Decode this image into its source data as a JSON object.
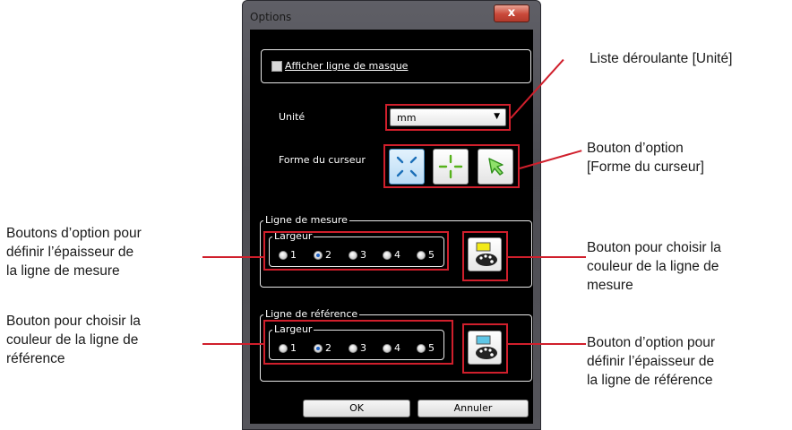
{
  "dialog": {
    "title": "Options",
    "close_label": "x",
    "mask_checkbox_label": "Afficher ligne de masque",
    "mask_checked": false,
    "unit_label": "Unité",
    "unit_value": "mm",
    "cursor_label": "Forme du curseur",
    "cursor_options": [
      "cross-cursor-icon",
      "center-cross-cursor-icon",
      "arrow-cursor-icon"
    ],
    "measure_group": {
      "title": "Ligne de mesure",
      "width_title": "Largeur",
      "options": [
        "1",
        "2",
        "3",
        "4",
        "5"
      ],
      "selected": "2",
      "swatch_color": "#f3ea16"
    },
    "reference_group": {
      "title": "Ligne de référence",
      "width_title": "Largeur",
      "options": [
        "1",
        "2",
        "3",
        "4",
        "5"
      ],
      "selected": "2",
      "swatch_color": "#5ec6e6"
    },
    "ok_label": "OK",
    "cancel_label": "Annuler"
  },
  "callouts": {
    "unit_dropdown": "Liste déroulante [Unité]",
    "cursor_option_1": "Bouton d’option",
    "cursor_option_2": "[Forme du curseur]",
    "measure_width_1": "Boutons d’option pour",
    "measure_width_2": "définir l’épaisseur de",
    "measure_width_3": "la ligne de mesure",
    "measure_color_1": "Bouton pour choisir la",
    "measure_color_2": "couleur de la ligne de",
    "measure_color_3": "mesure",
    "ref_color_1": "Bouton pour choisir la",
    "ref_color_2": "couleur de la ligne de",
    "ref_color_3": "référence",
    "ref_width_1": "Bouton d’option pour",
    "ref_width_2": "définir l’épaisseur de",
    "ref_width_3": "la ligne de référence"
  },
  "colors": {
    "highlight": "#d01f2c",
    "cursor_icon_blue": "#1b6fb8",
    "cursor_icon_green": "#57b21c"
  }
}
